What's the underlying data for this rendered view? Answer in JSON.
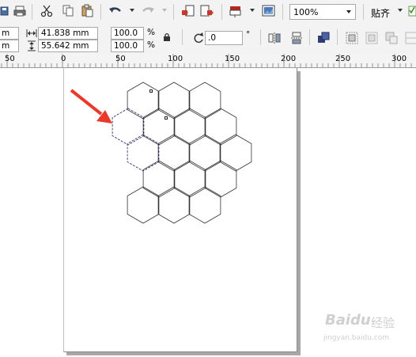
{
  "toolbar": {
    "zoom_value": "100%",
    "snap_label": "贴齐"
  },
  "property_bar": {
    "pos_x_value": "m",
    "pos_y_value": "m",
    "width_value": "41.838 mm",
    "height_value": "55.642 mm",
    "scale_x_value": "100.0",
    "scale_y_value": "100.0",
    "scale_x_unit": "%",
    "scale_y_unit": "%",
    "rotation_value": ".0",
    "rotation_unit": "°"
  },
  "ruler": {
    "labels": [
      "50",
      "0",
      "50",
      "100",
      "150",
      "200",
      "250",
      "300"
    ]
  },
  "canvas": {
    "arrow_color": "#e8392a"
  },
  "watermark": {
    "brand": "Baidu",
    "experience": "经验",
    "url": "jingyan.baidu.com"
  }
}
